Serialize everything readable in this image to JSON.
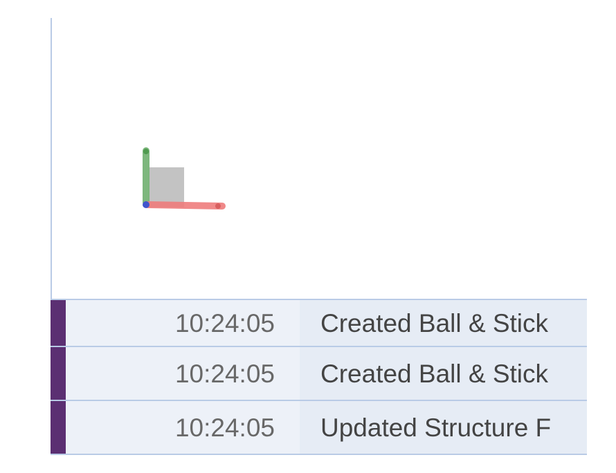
{
  "log": {
    "rows": [
      {
        "time": "10:24:05",
        "message": "Created Ball & Stick"
      },
      {
        "time": "10:24:05",
        "message": "Created Ball & Stick"
      },
      {
        "time": "10:24:05",
        "message": "Updated Structure F"
      }
    ]
  },
  "colors": {
    "accent_marker": "#5b2f72",
    "x_axis": "#ef7d7d",
    "y_axis": "#70b070",
    "z_axis": "#4055cc",
    "plane": "#bdbdbd",
    "border": "#b9cbe6"
  },
  "icons": {
    "orientation_axes": "orientation-axes-icon"
  }
}
